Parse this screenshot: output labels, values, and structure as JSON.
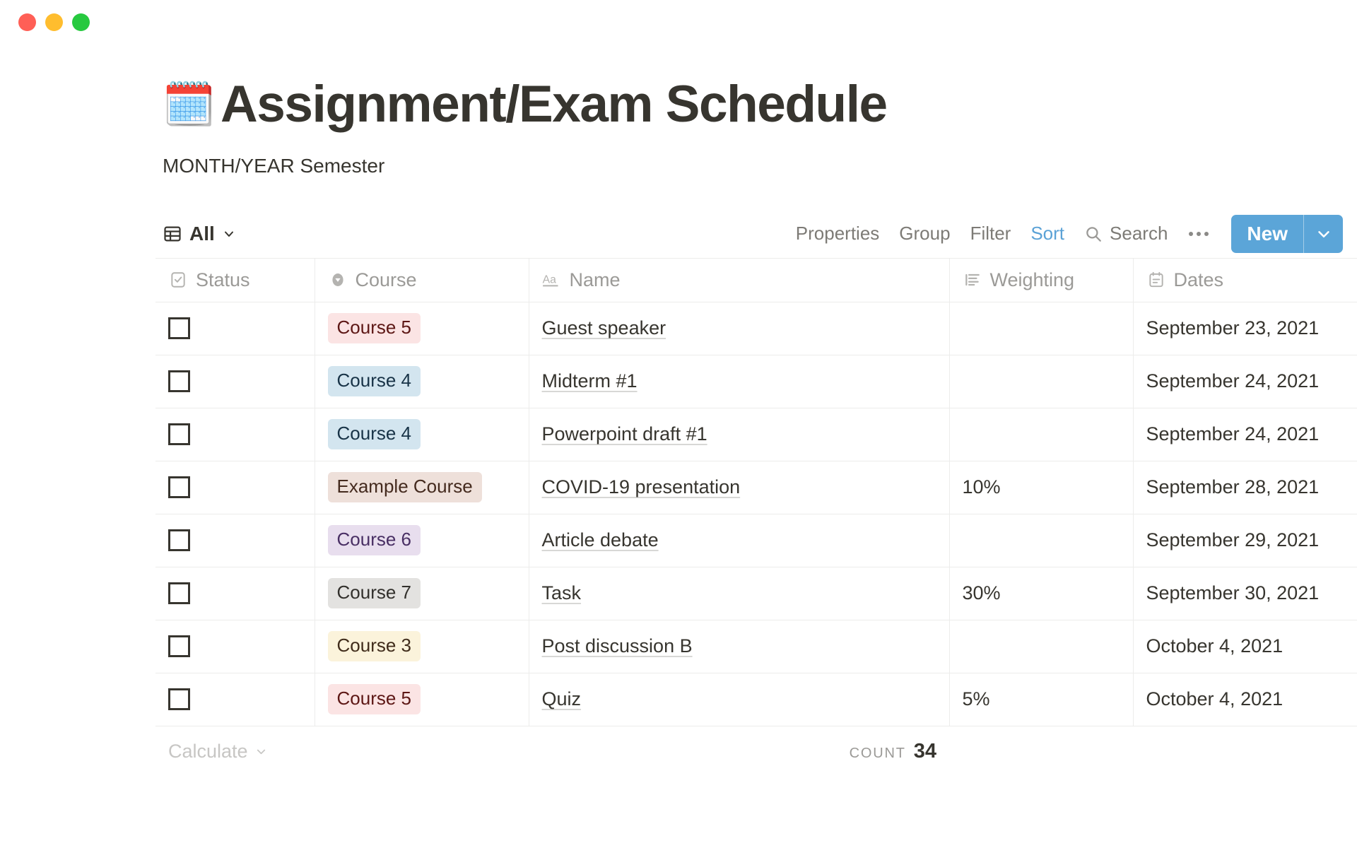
{
  "window": {
    "traffic_lights": [
      {
        "name": "close",
        "color": "#FF5F56"
      },
      {
        "name": "minimize",
        "color": "#FFBD2E"
      },
      {
        "name": "maximize",
        "color": "#27C93F"
      }
    ]
  },
  "header": {
    "emoji": "🗓️",
    "emoji_name": "spiral-calendar-emoji",
    "title": "Assignment/Exam Schedule",
    "subtitle": "MONTH/YEAR Semester"
  },
  "toolbar": {
    "view_label": "All",
    "view_icon": "table-view-icon",
    "chevron_icon": "chevron-down-icon",
    "actions": [
      {
        "label": "Properties",
        "active": false
      },
      {
        "label": "Group",
        "active": false
      },
      {
        "label": "Filter",
        "active": false
      },
      {
        "label": "Sort",
        "active": true
      }
    ],
    "search_label": "Search",
    "search_icon": "search-icon",
    "more_icon": "ellipsis-icon",
    "new_label": "New",
    "new_caret_icon": "chevron-down-icon",
    "accent_color": "#5BA5D8",
    "active_color": "#5BA2D6"
  },
  "table": {
    "columns": [
      {
        "key": "status",
        "label": "Status",
        "icon": "checkbox-icon"
      },
      {
        "key": "course",
        "label": "Course",
        "icon": "select-icon"
      },
      {
        "key": "name",
        "label": "Name",
        "icon": "text-aa-icon"
      },
      {
        "key": "weighting",
        "label": "Weighting",
        "icon": "text-lines-icon"
      },
      {
        "key": "dates",
        "label": "Dates",
        "icon": "calendar-icon"
      }
    ],
    "tag_styles": {
      "Course 5": {
        "bg": "#FBE4E4",
        "fg": "#5D1715"
      },
      "Course 4": {
        "bg": "#D3E5EF",
        "fg": "#183347"
      },
      "Example Course": {
        "bg": "#EEE0DA",
        "fg": "#442A1E"
      },
      "Course 6": {
        "bg": "#E8DEEE",
        "fg": "#492F64"
      },
      "Course 7": {
        "bg": "#E3E2E0",
        "fg": "#32302C"
      },
      "Course 3": {
        "bg": "#FBF3DB",
        "fg": "#402C1B"
      }
    },
    "rows": [
      {
        "status": false,
        "course": "Course 5",
        "name": "Guest speaker",
        "weighting": "",
        "dates": "September 23, 2021"
      },
      {
        "status": false,
        "course": "Course 4",
        "name": "Midterm #1",
        "weighting": "",
        "dates": "September 24, 2021"
      },
      {
        "status": false,
        "course": "Course 4",
        "name": "Powerpoint draft #1",
        "weighting": "",
        "dates": "September 24, 2021"
      },
      {
        "status": false,
        "course": "Example Course",
        "name": "COVID-19 presentation",
        "weighting": "10%",
        "dates": "September 28, 2021"
      },
      {
        "status": false,
        "course": "Course 6",
        "name": "Article debate",
        "weighting": "",
        "dates": "September 29, 2021"
      },
      {
        "status": false,
        "course": "Course 7",
        "name": "Task",
        "weighting": "30%",
        "dates": "September 30, 2021"
      },
      {
        "status": false,
        "course": "Course 3",
        "name": "Post discussion B",
        "weighting": "",
        "dates": "October 4, 2021"
      },
      {
        "status": false,
        "course": "Course 5",
        "name": "Quiz",
        "weighting": "5%",
        "dates": "October 4, 2021"
      }
    ]
  },
  "footer": {
    "calculate_label": "Calculate",
    "calculate_caret_icon": "chevron-down-icon",
    "count_label": "Count",
    "count_value": "34"
  }
}
